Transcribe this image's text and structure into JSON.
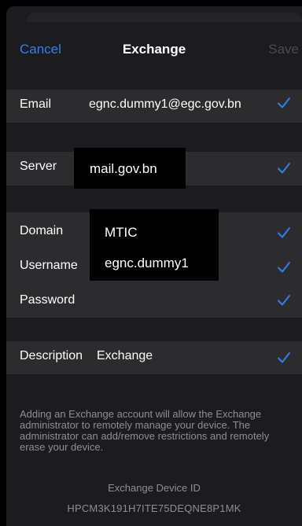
{
  "nav": {
    "cancel_label": "Cancel",
    "title": "Exchange",
    "save_label": "Save"
  },
  "fields": {
    "email": {
      "label": "Email",
      "value": "egnc.dummy1@egc.gov.bn"
    },
    "server": {
      "label": "Server",
      "value": "mail.gov.bn"
    },
    "domain": {
      "label": "Domain",
      "value": "MTIC"
    },
    "username": {
      "label": "Username",
      "value": "egnc.dummy1"
    },
    "password": {
      "label": "Password",
      "value": ""
    },
    "description": {
      "label": "Description",
      "value": "Exchange"
    }
  },
  "footer": {
    "info_text": "Adding an Exchange account will allow the Exchange administrator to remotely manage your device. The administrator can add/remove restrictions and remotely erase your device.",
    "device_id_label": "Exchange Device ID",
    "device_id_value": "HPCM3K191H7ITE75DEQNE8P1MK"
  },
  "colors": {
    "accent": "#2f80ed",
    "background": "#1c1c1e",
    "cell": "#2c2c2e",
    "secondary_text": "#8e8e93"
  },
  "icons": {
    "checkmark": "checkmark-icon"
  }
}
